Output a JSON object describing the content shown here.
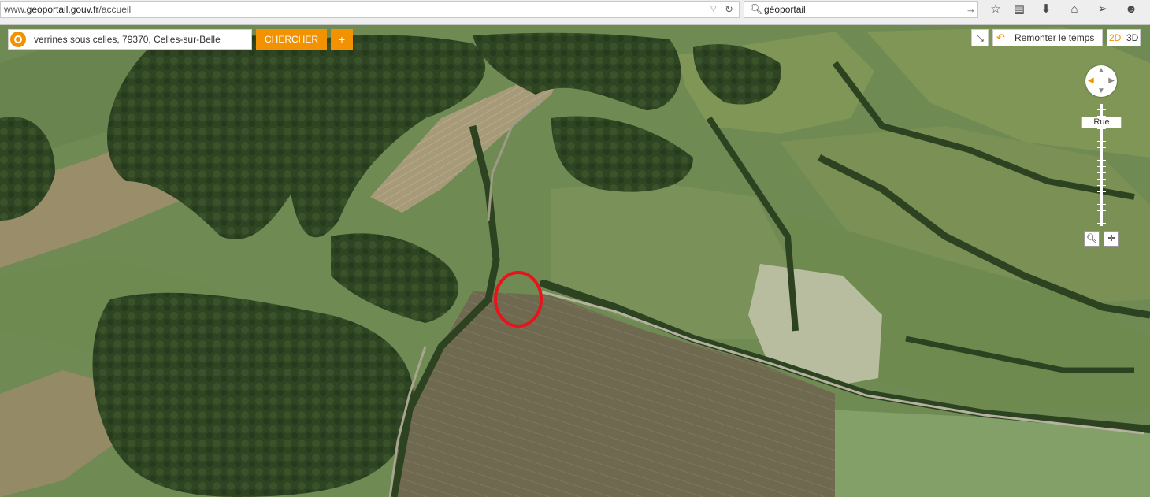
{
  "browser": {
    "url_domain": "www.",
    "url_host": "geoportail.gouv.fr",
    "url_path": "/accueil",
    "search_value": "géoportail",
    "icons": [
      "dropdown-icon",
      "reload-icon",
      "search-icon",
      "go-arrow-icon",
      "star-icon",
      "clipboard-icon",
      "download-icon",
      "home-icon",
      "send-icon",
      "chat-icon"
    ]
  },
  "map_ui": {
    "search_value": "verrines sous celles, 79370, Celles-sur-Belle",
    "search_button": "CHERCHER",
    "plus_button": "+",
    "remonter_label": "Remonter le temps",
    "mode_2d": "2D",
    "mode_3d": "3D",
    "zoom_level_label": "Rue",
    "accent_color": "#f39200",
    "marker_color": "#e8141b"
  }
}
